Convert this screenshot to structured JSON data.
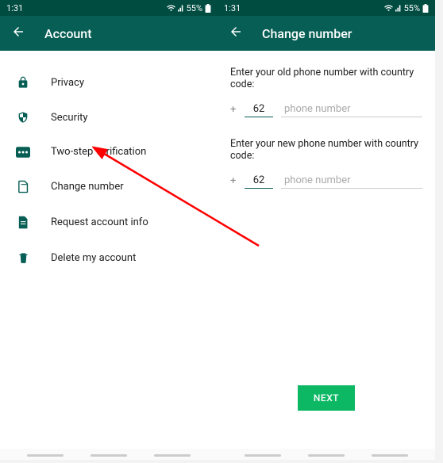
{
  "status": {
    "time": "1:31",
    "battery": "55%"
  },
  "left": {
    "title": "Account",
    "items": [
      {
        "label": "Privacy",
        "icon": "lock-icon"
      },
      {
        "label": "Security",
        "icon": "shield-icon"
      },
      {
        "label": "Two-step verification",
        "icon": "dots-icon"
      },
      {
        "label": "Change number",
        "icon": "sim-icon"
      },
      {
        "label": "Request account info",
        "icon": "doc-icon"
      },
      {
        "label": "Delete my account",
        "icon": "trash-icon"
      }
    ]
  },
  "right": {
    "title": "Change number",
    "old_label": "Enter your old phone number with country code:",
    "new_label": "Enter your new phone number with country code:",
    "plus": "+",
    "old_cc": "62",
    "new_cc": "62",
    "phone_placeholder": "phone number",
    "next": "NEXT"
  }
}
